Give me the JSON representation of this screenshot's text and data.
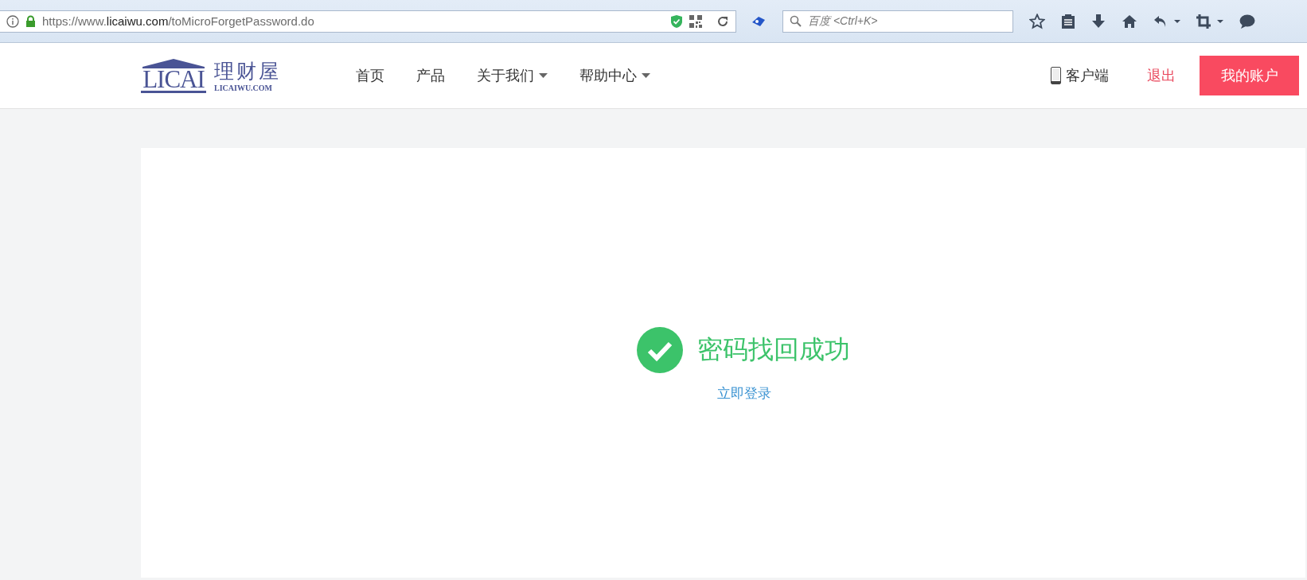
{
  "browser": {
    "url_parts": [
      {
        "text": "https://www.",
        "emphasis": false
      },
      {
        "text": "licaiwu.com",
        "emphasis": true
      },
      {
        "text": "/toMicroForgetPassword.do",
        "emphasis": false
      }
    ],
    "search": {
      "placeholder": "百度 <Ctrl+K>"
    }
  },
  "header": {
    "logo": {
      "mark": "LICAI",
      "name": "理财屋",
      "domain": "LICAIWU.COM"
    },
    "nav": [
      {
        "label": "首页",
        "has_menu": false
      },
      {
        "label": "产品",
        "has_menu": false
      },
      {
        "label": "关于我们",
        "has_menu": true
      },
      {
        "label": "帮助中心",
        "has_menu": true
      }
    ],
    "client_link": "客户端",
    "logout_link": "退出",
    "account_button": "我的账户"
  },
  "result": {
    "succeeded": true,
    "message": "密码找回成功",
    "link": "立即登录"
  }
}
